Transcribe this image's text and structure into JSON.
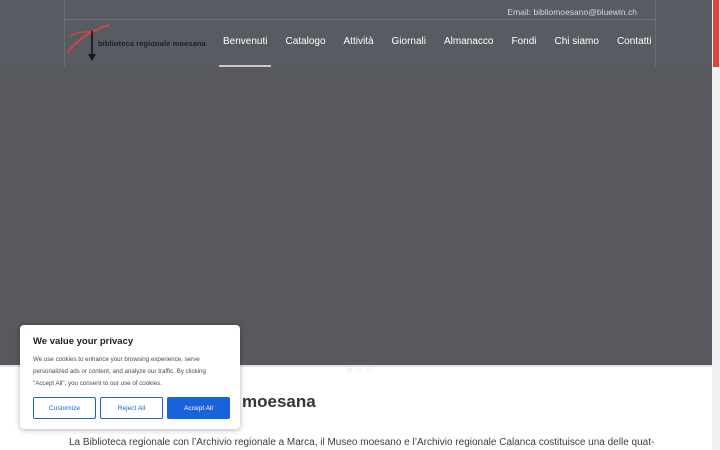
{
  "header": {
    "email": "Email: bibliomoesano@bluewin.ch",
    "logo_text": "biblioteca regionale moesana",
    "nav": [
      {
        "label": "Benvenuti",
        "active": true
      },
      {
        "label": "Catalogo"
      },
      {
        "label": "Attività"
      },
      {
        "label": "Giornali"
      },
      {
        "label": "Almanacco"
      },
      {
        "label": "Fondi"
      },
      {
        "label": "Chi siamo"
      },
      {
        "label": "Contatti"
      }
    ]
  },
  "hero": {
    "slide_count": 3,
    "active_slide": 1
  },
  "content": {
    "title": "moesana",
    "text": "La Biblioteca regionale con l’Archivio regionale a Marca, il Museo moesano e l’Archivio regionale Calanca costituisce una delle quat-"
  },
  "cookie": {
    "title": "We value your privacy",
    "text": "We use cookies to enhance your browsing experience, serve personalized ads or content, and analyze our traffic. By clicking \"Accept All\", you consent to our use of cookies.",
    "customize": "Customize",
    "reject": "Reject All",
    "accept": "Accept All"
  },
  "colors": {
    "header_bg": "#585b61",
    "hero_bg": "#57595f",
    "accent_red": "#d7473f",
    "cookie_blue": "#1863dc"
  }
}
